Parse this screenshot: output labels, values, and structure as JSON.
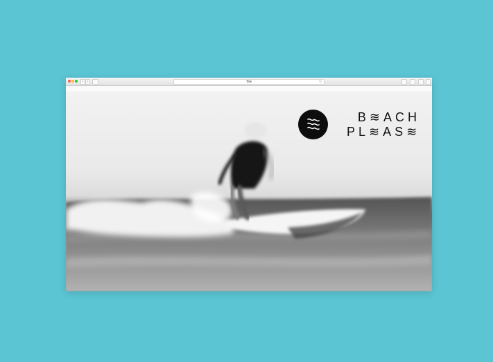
{
  "browser": {
    "tab_title": "Title",
    "nav_back": "‹",
    "nav_forward": "›",
    "reload": "↻"
  },
  "brand": {
    "line1": "B≋ACH",
    "line2": "PL≋AS≋"
  },
  "colors": {
    "background": "#5bc5d3",
    "badge": "#0d0d0d"
  }
}
